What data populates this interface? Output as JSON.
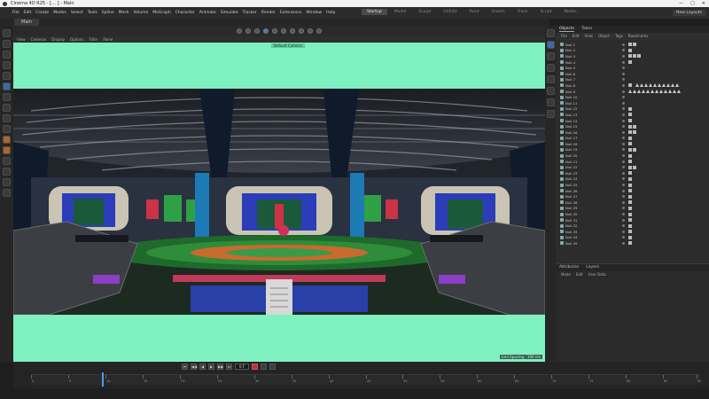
{
  "window": {
    "title": "Cinema 4D R25 - [… ] - Main",
    "controls": [
      "—",
      "□",
      "✕"
    ]
  },
  "menubar": {
    "items": [
      "File",
      "Edit",
      "Create",
      "Modes",
      "Select",
      "Tools",
      "Spline",
      "Mesh",
      "Volume",
      "MoGraph",
      "Character",
      "Animate",
      "Simulate",
      "Tracker",
      "Render",
      "Extensions",
      "Window",
      "Help"
    ],
    "layouts": [
      "Startup",
      "Model",
      "Sculpt",
      "UVEdit",
      "Paint",
      "Groom",
      "Track",
      "Script",
      "Nodes"
    ],
    "active_layout": "Startup",
    "new_layouts": "New Layouts"
  },
  "tabsbar": {
    "doc_label": "Main"
  },
  "viewport": {
    "menu": [
      "View",
      "Cameras",
      "Display",
      "Options",
      "Filter",
      "Panel"
    ],
    "indicator": "Default Camera",
    "frame_info": "Grid Spacing : 100 cm"
  },
  "objects": {
    "tabs": [
      "Objects",
      "Takes"
    ],
    "menu": [
      "File",
      "Edit",
      "View",
      "Object",
      "Tags",
      "Bookmarks"
    ],
    "rows": [
      {
        "name": "Null.1",
        "tags": 2,
        "tri": 0
      },
      {
        "name": "Null.2",
        "tags": 1,
        "tri": 0
      },
      {
        "name": "Null.3",
        "tags": 3,
        "tri": 0
      },
      {
        "name": "Null.4",
        "tags": 1,
        "tri": 0
      },
      {
        "name": "Null.5",
        "tags": 0,
        "tri": 0
      },
      {
        "name": "Null.6",
        "tags": 0,
        "tri": 0
      },
      {
        "name": "Null.7",
        "tags": 0,
        "tri": 0
      },
      {
        "name": "Null.8",
        "tags": 1,
        "tri": 10
      },
      {
        "name": "Null.9",
        "tags": 0,
        "tri": 12
      },
      {
        "name": "Null.10",
        "tags": 0,
        "tri": 0
      },
      {
        "name": "Null.11",
        "tags": 0,
        "tri": 0
      },
      {
        "name": "Null.12",
        "tags": 1,
        "tri": 0
      },
      {
        "name": "Null.13",
        "tags": 1,
        "tri": 0
      },
      {
        "name": "Null.14",
        "tags": 1,
        "tri": 0
      },
      {
        "name": "Null.15",
        "tags": 2,
        "tri": 0
      },
      {
        "name": "Null.16",
        "tags": 2,
        "tri": 0
      },
      {
        "name": "Null.17",
        "tags": 1,
        "tri": 0
      },
      {
        "name": "Null.18",
        "tags": 1,
        "tri": 0
      },
      {
        "name": "Null.19",
        "tags": 2,
        "tri": 0
      },
      {
        "name": "Null.20",
        "tags": 1,
        "tri": 0
      },
      {
        "name": "Null.21",
        "tags": 1,
        "tri": 0
      },
      {
        "name": "Null.22",
        "tags": 2,
        "tri": 0
      },
      {
        "name": "Null.23",
        "tags": 1,
        "tri": 0
      },
      {
        "name": "Null.24",
        "tags": 1,
        "tri": 0
      },
      {
        "name": "Null.25",
        "tags": 1,
        "tri": 0
      },
      {
        "name": "Null.26",
        "tags": 1,
        "tri": 0
      },
      {
        "name": "Null.27",
        "tags": 1,
        "tri": 0
      },
      {
        "name": "Null.28",
        "tags": 1,
        "tri": 0
      },
      {
        "name": "Null.29",
        "tags": 1,
        "tri": 0
      },
      {
        "name": "Null.30",
        "tags": 1,
        "tri": 0
      },
      {
        "name": "Null.31",
        "tags": 1,
        "tri": 0
      },
      {
        "name": "Null.32",
        "tags": 1,
        "tri": 0
      },
      {
        "name": "Null.33",
        "tags": 1,
        "tri": 0
      },
      {
        "name": "Null.34",
        "tags": 1,
        "tri": 0
      },
      {
        "name": "Null.35",
        "tags": 1,
        "tri": 0
      }
    ]
  },
  "attributes": {
    "tabs": [
      "Attributes",
      "Layers"
    ],
    "menu": [
      "Mode",
      "Edit",
      "User Data"
    ]
  },
  "timeline": {
    "current_frame": "0 F",
    "buttons": [
      "⏮",
      "◀◀",
      "◀",
      "▶",
      "▶▶",
      "⏭"
    ],
    "ruler": [
      "0",
      "5",
      "10",
      "15",
      "20",
      "25",
      "30",
      "35",
      "40",
      "45",
      "50",
      "55",
      "60",
      "65",
      "70",
      "75",
      "80",
      "85",
      "90"
    ],
    "status": ""
  },
  "colors": {
    "viewport_bg": "#7ff0c0",
    "accent": "#3b7fc4"
  }
}
